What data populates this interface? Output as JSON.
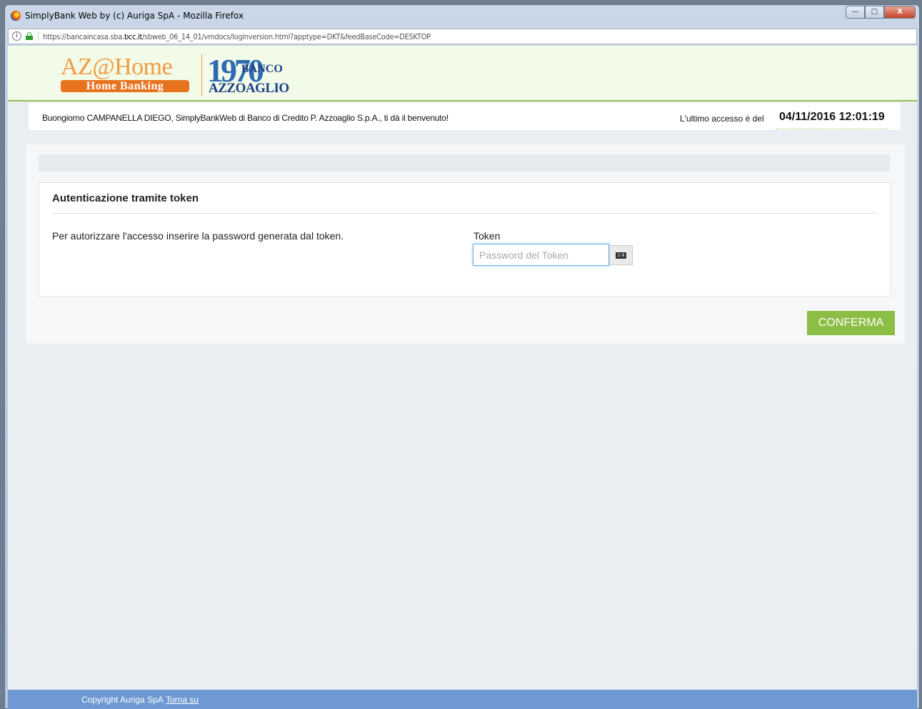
{
  "window": {
    "title": "SimplyBank Web by (c) Auriga SpA - Mozilla Firefox",
    "buttons": {
      "minimize": "—",
      "maximize": "□",
      "close": "X"
    }
  },
  "urlbar": {
    "info": "i",
    "url_prefix": "https://bancaincasa.sba.",
    "url_domain": "bcc.it",
    "url_suffix": "/sbweb_06_14_01/vmdocs/loginversion.html?apptype=DKT&feedBaseCode=DESKTOP"
  },
  "brand": {
    "az_home": "AZ@Home",
    "home_banking": "Home Banking",
    "year": "1970",
    "banco": "BANCO",
    "azzoaglio": "AZZOAGLIO"
  },
  "welcome": {
    "text": "Buongiorno CAMPANELLA DIEGO, SimplyBankWeb di Banco di Credito P. Azzoaglio S.p.A., ti dà il benvenuto!",
    "last_access_label": "L'ultimo accesso è del",
    "last_access_date": "04/11/2016 12:01:19"
  },
  "auth": {
    "title": "Autenticazione tramite token",
    "description": "Per autorizzare l'accesso inserire la password generata dal token.",
    "token_label": "Token",
    "token_placeholder": "Password del Token",
    "keypad_label": "1-9",
    "confirm_label": "CONFERMA"
  },
  "footer": {
    "copyright": "Copyright Auriga SpA",
    "back_to_top": "Torna su"
  }
}
